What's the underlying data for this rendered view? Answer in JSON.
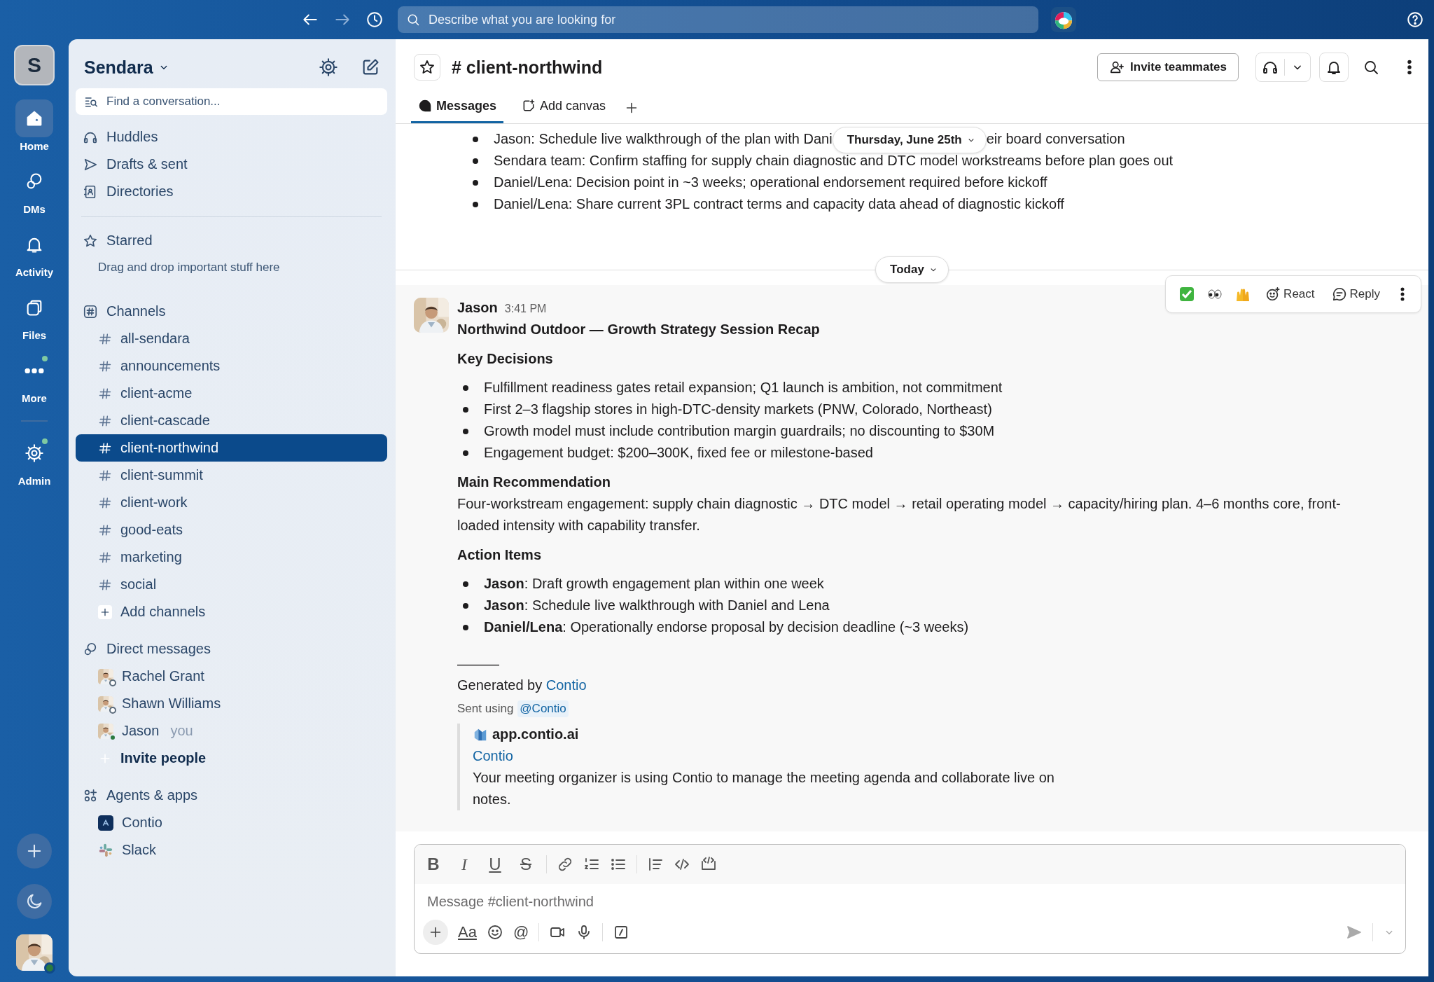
{
  "topbar": {
    "search_placeholder": "Describe what you are looking for"
  },
  "rail": {
    "workspace_initial": "S",
    "items": [
      {
        "label": "Home",
        "selected": true,
        "unread": false
      },
      {
        "label": "DMs",
        "selected": false,
        "unread": false
      },
      {
        "label": "Activity",
        "selected": false,
        "unread": false
      },
      {
        "label": "Files",
        "selected": false,
        "unread": false
      },
      {
        "label": "More",
        "selected": false,
        "unread": true
      },
      {
        "label": "Admin",
        "selected": false,
        "unread": true
      }
    ],
    "user": {
      "online": true
    }
  },
  "sidebar": {
    "workspace": "Sendara",
    "search_placeholder": "Find a conversation...",
    "nav": [
      {
        "label": "Huddles"
      },
      {
        "label": "Drafts & sent"
      },
      {
        "label": "Directories"
      }
    ],
    "starred": {
      "title": "Starred",
      "hint": "Drag and drop important stuff here"
    },
    "channels": {
      "title": "Channels",
      "items": [
        {
          "name": "all-sendara",
          "selected": false
        },
        {
          "name": "announcements",
          "selected": false
        },
        {
          "name": "client-acme",
          "selected": false
        },
        {
          "name": "client-cascade",
          "selected": false
        },
        {
          "name": "client-northwind",
          "selected": true
        },
        {
          "name": "client-summit",
          "selected": false
        },
        {
          "name": "client-work",
          "selected": false
        },
        {
          "name": "good-eats",
          "selected": false
        },
        {
          "name": "marketing",
          "selected": false
        },
        {
          "name": "social",
          "selected": false
        }
      ],
      "add": "Add channels"
    },
    "dms": {
      "title": "Direct messages",
      "items": [
        {
          "name": "Rachel Grant",
          "online": false
        },
        {
          "name": "Shawn Williams",
          "online": false
        },
        {
          "name": "Jason",
          "note": "you",
          "online": true
        }
      ],
      "invite": "Invite people"
    },
    "apps": {
      "title": "Agents & apps",
      "items": [
        {
          "name": "Contio",
          "kind": "contio"
        },
        {
          "name": "Slack",
          "kind": "slack"
        }
      ]
    }
  },
  "channel": {
    "title": "# client-northwind",
    "invite": "Invite teammates",
    "tabs": [
      {
        "label": "Messages",
        "selected": true
      },
      {
        "label": "Add canvas",
        "selected": false
      }
    ]
  },
  "earlier": {
    "first_start": "Jason: Schedule live walkthrough of the plan with Dani",
    "first_end": "eir board conversation",
    "date_pill": "Thursday, June 25th",
    "bullets": [
      "Sendara team: Confirm staffing for supply chain diagnostic and DTC model workstreams before plan goes out",
      "Daniel/Lena: Decision point in ~3 weeks; operational endorsement required before kickoff",
      "Daniel/Lena: Share current 3PL contract terms and capacity data ahead of diagnostic kickoff"
    ]
  },
  "today": "Today",
  "hover_actions": {
    "react": "React",
    "reply": "Reply"
  },
  "message": {
    "author": "Jason",
    "time": "3:41 PM",
    "title": "Northwind Outdoor — Growth Strategy Session Recap",
    "sections": [
      {
        "kind": "list",
        "heading": "Key Decisions",
        "items": [
          "Fulfillment readiness gates retail expansion; Q1 launch is ambition, not commitment",
          "First 2–3 flagship stores in high-DTC-density markets (PNW, Colorado, Northeast)",
          "Growth model must include contribution margin guardrails; no discounting to $30M",
          "Engagement budget: $200–300K, fixed fee or milestone-based"
        ]
      },
      {
        "kind": "paragraph",
        "heading": "Main Recommendation",
        "text": "Four-workstream engagement: supply chain diagnostic → DTC model → retail operating model → capacity/hiring plan. 4–6 months core, front-loaded intensity with capability transfer."
      },
      {
        "kind": "list",
        "heading": "Action Items",
        "items": [
          "**Jason**: Draft growth engagement plan within one week",
          "**Jason**: Schedule live walkthrough with Daniel and Lena",
          "**Daniel/Lena**: Operationally endorse proposal by decision deadline (~3 weeks)"
        ]
      }
    ],
    "rule": "———",
    "generated": {
      "text": "Generated by",
      "link": "Contio"
    },
    "sent_using": {
      "text": "Sent using",
      "mention": "@Contio"
    },
    "unfurl": {
      "site": "app.contio.ai",
      "title": "Contio",
      "description": "Your meeting organizer is using Contio to manage the meeting agenda and collaborate live on notes."
    }
  },
  "composer": {
    "placeholder": "Message #client-northwind",
    "format_letters": [
      "B",
      "I",
      "U",
      "S"
    ],
    "text_tool": "Aa",
    "mention_tool": "@"
  }
}
